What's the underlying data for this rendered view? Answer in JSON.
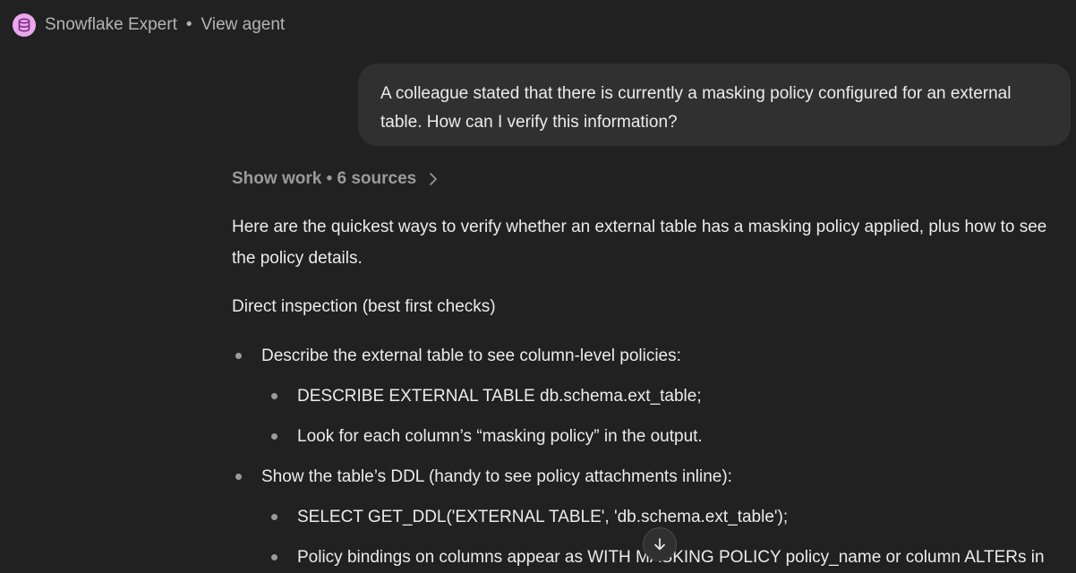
{
  "header": {
    "agent_name": "Snowflake Expert",
    "separator": "•",
    "view_agent_label": "View agent"
  },
  "user_message": "A colleague stated that there is currently a masking policy configured for an external table. How can I verify this information?",
  "show_work": {
    "label": "Show work • 6 sources"
  },
  "answer": {
    "intro": "Here are the quickest ways to verify whether an external table has a masking policy applied, plus how to see the policy details.",
    "section_heading": "Direct inspection (best first checks)",
    "items": [
      {
        "text": "Describe the external table to see column-level policies:",
        "subitems": [
          "DESCRIBE EXTERNAL TABLE db.schema.ext_table;",
          "Look for each column’s “masking policy” in the output."
        ]
      },
      {
        "text": "Show the table’s DDL (handy to see policy attachments inline):",
        "subitems": [
          "SELECT GET_DDL('EXTERNAL TABLE', 'db.schema.ext_table');",
          "Policy bindings on columns appear as WITH MASKING POLICY policy_name or column ALTERs in"
        ]
      }
    ]
  },
  "icons": {
    "agent_avatar": "database-icon",
    "show_work_chevron": "chevron-right-icon",
    "scroll_down": "arrow-down-icon"
  },
  "colors": {
    "background": "#212121",
    "user_bubble": "#303030",
    "avatar": "#e9a8ec",
    "muted_text": "#b4b4b4"
  }
}
